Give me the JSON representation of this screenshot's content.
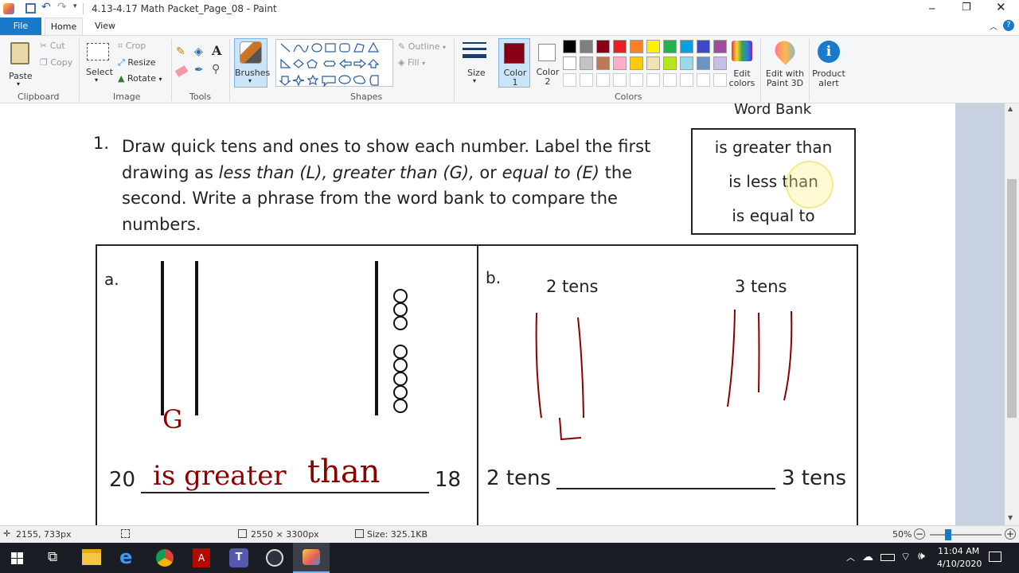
{
  "window": {
    "title": "4.13-4.17 Math Packet_Page_08 - Paint"
  },
  "menu": {
    "file": "File",
    "home": "Home",
    "view": "View"
  },
  "ribbon": {
    "clipboard": {
      "paste": "Paste",
      "cut": "Cut",
      "copy": "Copy",
      "group": "Clipboard"
    },
    "image": {
      "select": "Select",
      "crop": "Crop",
      "resize": "Resize",
      "rotate": "Rotate",
      "group": "Image"
    },
    "tools": {
      "group": "Tools"
    },
    "brushes": {
      "label": "Brushes"
    },
    "shapes": {
      "outline": "Outline",
      "fill": "Fill",
      "group": "Shapes"
    },
    "size": {
      "label": "Size"
    },
    "color1": {
      "label": "Color 1",
      "value": "#880015"
    },
    "color2": {
      "label": "Color 2",
      "value": "#ffffff"
    },
    "colors": {
      "group": "Colors",
      "edit": "Edit colors"
    },
    "paint3d": {
      "label": "Edit with Paint 3D"
    },
    "product_alert": {
      "label": "Product alert"
    },
    "palette": [
      "#000000",
      "#7f7f7f",
      "#880015",
      "#ed1c24",
      "#ff7f27",
      "#fff200",
      "#22b14c",
      "#00a2e8",
      "#3f48cc",
      "#a349a4",
      "#ffffff",
      "#c3c3c3",
      "#b97a57",
      "#ffaec9",
      "#ffc90e",
      "#efe4b0",
      "#b5e61d",
      "#99d9ea",
      "#7092be",
      "#c8bfe7"
    ]
  },
  "document": {
    "word_bank_title": "Word Bank",
    "word_bank": [
      "is greater than",
      "is less than",
      "is equal to"
    ],
    "q_number": "1.",
    "q_line1": "Draw quick tens and ones to show each number.  Label the first",
    "q_line2a": "drawing as ",
    "q_line2b": "less than (L), greater than (G),",
    "q_line2c": " or ",
    "q_line2d": "equal to (E)",
    "q_line2e": " the",
    "q_line3": "second.  Write a phrase from the word bank to compare the",
    "q_line4": "numbers.",
    "a": {
      "label": "a.",
      "left_num": "20",
      "right_num": "18",
      "mark": "G",
      "answer_1": "is greater",
      "answer_2": "than"
    },
    "b": {
      "label": "b.",
      "left_head": "2 tens",
      "right_head": "3 tens",
      "left_num": "2 tens",
      "right_num": "3 tens",
      "mark": "L"
    }
  },
  "status": {
    "cursor": "2155, 733px",
    "dimensions": "2550 × 3300px",
    "size": "Size: 325.1KB",
    "zoom": "50%"
  },
  "taskbar": {
    "time": "11:04 AM",
    "date": "4/10/2020"
  }
}
